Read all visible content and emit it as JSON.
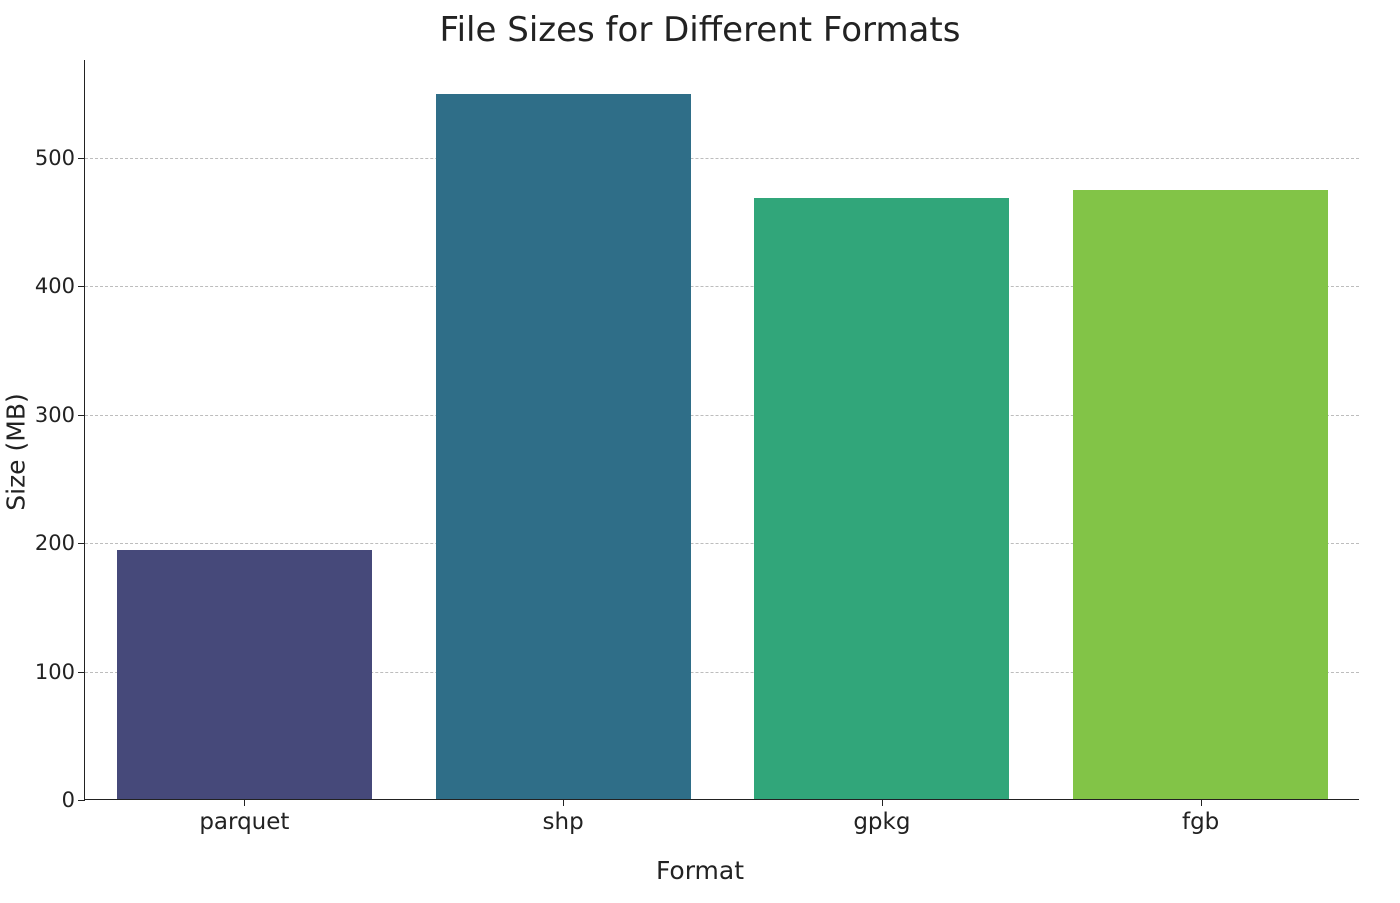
{
  "chart_data": {
    "type": "bar",
    "title": "File Sizes for Different Formats",
    "xlabel": "Format",
    "ylabel": "Size (MB)",
    "categories": [
      "parquet",
      "shp",
      "gpkg",
      "fgb"
    ],
    "values": [
      194,
      549,
      468,
      474
    ],
    "y_ticks": [
      0,
      100,
      200,
      300,
      400,
      500
    ],
    "ylim": [
      0,
      576
    ],
    "colors": [
      "#46497a",
      "#2f6e88",
      "#31a67a",
      "#82c447"
    ]
  }
}
